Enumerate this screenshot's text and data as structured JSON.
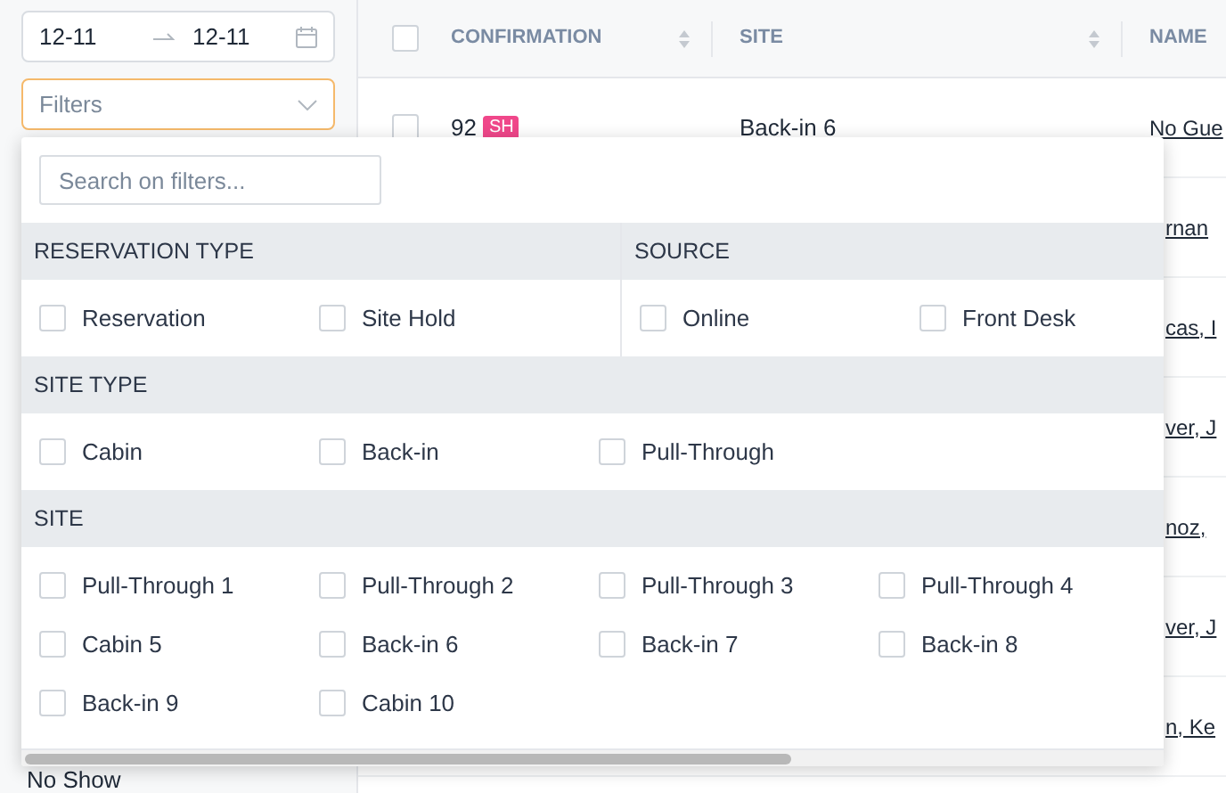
{
  "date_range": {
    "start": "12-11",
    "end": "12-11"
  },
  "filter_select": {
    "placeholder": "Filters"
  },
  "sidebar_footer": "No Show",
  "table": {
    "select_all_checked": false,
    "columns": [
      {
        "label": "CONFIRMATION",
        "sortable": true
      },
      {
        "label": "SITE",
        "sortable": true
      },
      {
        "label": "NAME",
        "sortable": false
      }
    ],
    "rows": [
      {
        "checked": false,
        "confirmation": "92",
        "badge": "SH",
        "site": "Back-in 6",
        "name": "No Gue"
      },
      {
        "name": "rnan"
      },
      {
        "name": "cas, I"
      },
      {
        "name": "ver, J"
      },
      {
        "name": "noz,"
      },
      {
        "name": "ver, J"
      },
      {
        "name": "n, Ke"
      }
    ]
  },
  "filter_panel": {
    "search": {
      "placeholder": "Search on filters..."
    },
    "groups": [
      {
        "title": "RESERVATION TYPE",
        "kind": "half",
        "options": [
          {
            "label": "Reservation",
            "checked": false
          },
          {
            "label": "Site Hold",
            "checked": false
          }
        ]
      },
      {
        "title": "SOURCE",
        "kind": "half",
        "options": [
          {
            "label": "Online",
            "checked": false
          },
          {
            "label": "Front Desk",
            "checked": false
          }
        ]
      },
      {
        "title": "SITE TYPE",
        "kind": "full",
        "options": [
          {
            "label": "Cabin",
            "checked": false
          },
          {
            "label": "Back-in",
            "checked": false
          },
          {
            "label": "Pull-Through",
            "checked": false
          }
        ]
      },
      {
        "title": "SITE",
        "kind": "full",
        "options": [
          {
            "label": "Pull-Through 1",
            "checked": false
          },
          {
            "label": "Pull-Through 2",
            "checked": false
          },
          {
            "label": "Pull-Through 3",
            "checked": false
          },
          {
            "label": "Pull-Through 4",
            "checked": false
          },
          {
            "label": "Cabin 5",
            "checked": false
          },
          {
            "label": "Back-in 6",
            "checked": false
          },
          {
            "label": "Back-in 7",
            "checked": false
          },
          {
            "label": "Back-in 8",
            "checked": false
          },
          {
            "label": "Back-in 9",
            "checked": false
          },
          {
            "label": "Cabin 10",
            "checked": false
          }
        ]
      }
    ]
  }
}
